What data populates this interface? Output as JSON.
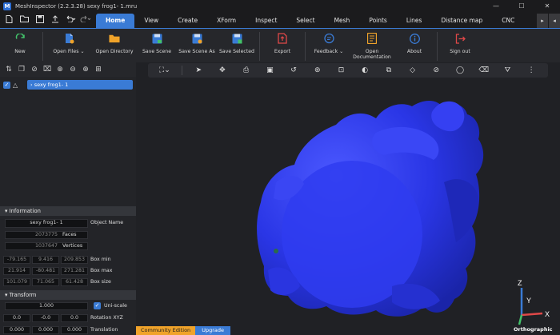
{
  "window": {
    "title": "MeshInspector (2.2.3.28) sexy frog1- 1.mru",
    "logo_glyph": "M",
    "controls": [
      "—",
      "☐",
      "✕"
    ]
  },
  "quick_access": [
    "file-icon",
    "folder-icon",
    "save-icon",
    "export-icon",
    "undo-icon",
    "redo-icon"
  ],
  "menu": {
    "tabs": [
      "Home",
      "View",
      "Create",
      "XForm",
      "Inspect",
      "Select",
      "Mesh",
      "Points",
      "Lines",
      "Distance map",
      "CNC"
    ],
    "active_tab": "Home",
    "right_buttons": [
      "▸",
      "◂"
    ]
  },
  "ribbon": {
    "buttons": [
      {
        "label": "New",
        "icon": "new-icon"
      },
      {
        "label": "Open Files",
        "icon": "open-files-icon",
        "dropdown": true
      },
      {
        "label": "Open Directory",
        "icon": "open-directory-icon"
      },
      {
        "label": "Save Scene",
        "icon": "save-scene-icon"
      },
      {
        "label": "Save Scene As",
        "icon": "save-scene-as-icon"
      },
      {
        "label": "Save Selected",
        "icon": "save-selected-icon"
      },
      {
        "label": "Export",
        "icon": "export-icon"
      },
      {
        "label": "Feedback",
        "icon": "feedback-icon",
        "dropdown": true
      },
      {
        "label": "Open Documentation",
        "icon": "documentation-icon"
      },
      {
        "label": "About",
        "icon": "about-icon"
      },
      {
        "label": "Sign out",
        "icon": "sign-out-icon"
      }
    ]
  },
  "scene_tree": {
    "object_name": "sexy frog1- 1",
    "checked": true
  },
  "information": {
    "header": "Information",
    "object_name": "sexy frog1- 1",
    "object_name_label": "Object Name",
    "faces": "2073775",
    "faces_label": "Faces",
    "vertices": "1037647",
    "vertices_label": "Vertices",
    "box_min": [
      "-79.165",
      "9.416",
      "209.853"
    ],
    "box_min_label": "Box min",
    "box_max": [
      "21.914",
      "-80.481",
      "271.281"
    ],
    "box_max_label": "Box max",
    "box_size": [
      "101.079",
      "71.065",
      "61.428"
    ],
    "box_size_label": "Box size"
  },
  "transform": {
    "header": "Transform",
    "scale": "1.000",
    "uniscale_label": "Uni-scale",
    "rotation": [
      "0.0",
      "-0.0",
      "0.0"
    ],
    "rotation_label": "Rotation XYZ",
    "translation": [
      "0.000",
      "0.000",
      "0.000"
    ],
    "translation_label": "Translation"
  },
  "viewport": {
    "axis_labels": {
      "z": "Z",
      "y": "Y",
      "x": "X"
    },
    "projection": "Orthographic",
    "edition_label": "Community Edition",
    "upgrade_label": "Upgrade",
    "mesh_color": "#2433e0"
  }
}
